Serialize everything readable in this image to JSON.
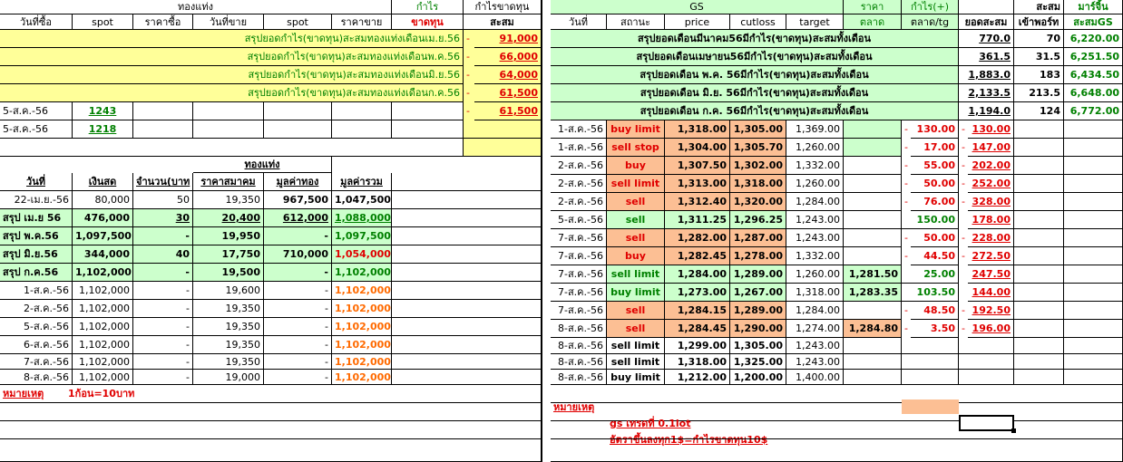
{
  "left": {
    "header1": {
      "gold": "ทองแท่ง",
      "profit": "กำไร",
      "profit_loss": "กำไรขาดทุน"
    },
    "header2": {
      "buy_date": "วันที่ซื้อ",
      "spot": "spot",
      "buy_price": "ราคาซื้อ",
      "sell_date": "วันที่ขาย",
      "spot2": "spot",
      "sell_price": "ราคาขาย",
      "loss": "ขาดทุน",
      "accum": "สะสม"
    },
    "summaries": [
      {
        "label": "สรุปยอดกำไร(ขาดทุน)สะสมทองแท่งเดือนเม.ย.56",
        "dash": "-",
        "value": "91,000"
      },
      {
        "label": "สรุปยอดกำไร(ขาดทุน)สะสมทองแท่งเดือนพ.ค.56",
        "dash": "-",
        "value": "66,000"
      },
      {
        "label": "สรุปยอดกำไร(ขาดทุน)สะสมทองแท่งเดือนมิ.ย.56",
        "dash": "-",
        "value": "64,000"
      },
      {
        "label": "สรุปยอดกำไร(ขาดทุน)สะสมทองแท่งเดือนก.ค.56",
        "dash": "-",
        "value": "61,500"
      }
    ],
    "open_rows": [
      {
        "date": "5-ส.ค.-56",
        "spot": "1243",
        "dash": "-",
        "value": "61,500"
      },
      {
        "date": "5-ส.ค.-56",
        "spot": "1218"
      }
    ],
    "gold_title": "ทองแท่ง",
    "table_headers": {
      "date": "วันที่",
      "cash": "เงินสด",
      "qty": "จำนวน(บาท",
      "price": "ราคาสมาคม",
      "gold_value": "มูลค่าทอง",
      "total": "มูลค่ารวม"
    },
    "rows": [
      {
        "date": "22-เม.ย.-56",
        "cash": "80,000",
        "qty": "50",
        "price": "19,350",
        "gold_value": "967,500",
        "total": "1,047,500"
      },
      {
        "date": "สรุป เม.ย 56",
        "cash": "476,000",
        "qty": "30",
        "price": "20,400",
        "gold_value": "612,000",
        "total": "1,088,000"
      },
      {
        "date": "สรุป พ.ค.56",
        "cash": "1,097,500",
        "qty": "-",
        "price": "19,950",
        "gold_value": "-",
        "total": "1,097,500"
      },
      {
        "date": "สรุป มิ.ย.56",
        "cash": "344,000",
        "qty": "40",
        "price": "17,750",
        "gold_value": "710,000",
        "total": "1,054,000"
      },
      {
        "date": "สรุป ก.ค.56",
        "cash": "1,102,000",
        "qty": "-",
        "price": "19,500",
        "gold_value": "-",
        "total": "1,102,000"
      },
      {
        "date": "1-ส.ค.-56",
        "cash": "1,102,000",
        "qty": "-",
        "price": "19,600",
        "gold_value": "-",
        "total": "1,102,000"
      },
      {
        "date": "2-ส.ค.-56",
        "cash": "1,102,000",
        "qty": "-",
        "price": "19,350",
        "gold_value": "-",
        "total": "1,102,000"
      },
      {
        "date": "5-ส.ค.-56",
        "cash": "1,102,000",
        "qty": "-",
        "price": "19,350",
        "gold_value": "-",
        "total": "1,102,000"
      },
      {
        "date": "6-ส.ค.-56",
        "cash": "1,102,000",
        "qty": "-",
        "price": "19,350",
        "gold_value": "-",
        "total": "1,102,000"
      },
      {
        "date": "7-ส.ค.-56",
        "cash": "1,102,000",
        "qty": "-",
        "price": "19,350",
        "gold_value": "-",
        "total": "1,102,000"
      },
      {
        "date": "8-ส.ค.-56",
        "cash": "1,102,000",
        "qty": "-",
        "price": "19,000",
        "gold_value": "-",
        "total": "1,102,000"
      }
    ],
    "note_label": "หมายเหตุ",
    "note_text": "1ก้อน=10บาท"
  },
  "right": {
    "header1": {
      "gs": "GS",
      "price": "ราคา",
      "profit": "กำไร(+)",
      "accum": "สะสม",
      "margin": "มาร์จิ้น"
    },
    "header2": {
      "date": "วันที่",
      "status": "สถานะ",
      "price": "price",
      "cutloss": "cutloss",
      "target": "target",
      "market": "ตลาด",
      "market_tg": "ตลาด/tg",
      "accum_total": "ยอดสะสม",
      "ports": "เข้าพอร์ท",
      "accum_gs": "สะสมGS"
    },
    "summaries": [
      {
        "label": "สรุปยอดเดือนมีนาคม56มีกำไร(ขาดทุน)สะสมทั้งเดือน",
        "total": "770.0",
        "ports": "70",
        "gs": "6,220.00"
      },
      {
        "label": "สรุปยอดเดือนเมษายน56มีกำไร(ขาดทุน)สะสมทั้งเดือน",
        "total": "361.5",
        "ports": "31.5",
        "gs": "6,251.50"
      },
      {
        "label": "สรุปยอดเดือน พ.ค. 56มีกำไร(ขาดทุน)สะสมทั้งเดือน",
        "total": "1,883.0",
        "ports": "183",
        "gs": "6,434.50"
      },
      {
        "label": "สรุปยอดเดือน มิ.ย. 56มีกำไร(ขาดทุน)สะสมทั้งเดือน",
        "total": "2,133.5",
        "ports": "213.5",
        "gs": "6,648.00"
      },
      {
        "label": "สรุปยอดเดือน ก.ค. 56มีกำไร(ขาดทุน)สะสมทั้งเดือน",
        "total": "1,194.0",
        "ports": "124",
        "gs": "6,772.00"
      }
    ],
    "trades": [
      {
        "date": "1-ส.ค.-56",
        "status": "buy limit",
        "price": "1,318.00",
        "cutloss": "1,305.00",
        "target": "1,369.00",
        "market": "",
        "dash": "-",
        "profit": "130.00",
        "accum": "130.00"
      },
      {
        "date": "1-ส.ค.-56",
        "status": "sell stop",
        "price": "1,304.00",
        "cutloss": "1,305.70",
        "target": "1,260.00",
        "market": "",
        "dash": "-",
        "profit": "17.00",
        "accum": "147.00"
      },
      {
        "date": "2-ส.ค.-56",
        "status": "buy",
        "price": "1,307.50",
        "cutloss": "1,302.00",
        "target": "1,332.00",
        "market": "",
        "dash": "-",
        "profit": "55.00",
        "accum": "202.00"
      },
      {
        "date": "2-ส.ค.-56",
        "status": "sell limit",
        "price": "1,313.00",
        "cutloss": "1,318.00",
        "target": "1,260.00",
        "market": "",
        "dash": "-",
        "profit": "50.00",
        "accum": "252.00"
      },
      {
        "date": "2-ส.ค.-56",
        "status": "sell",
        "price": "1,312.40",
        "cutloss": "1,320.00",
        "target": "1,284.00",
        "market": "",
        "dash": "-",
        "profit": "76.00",
        "accum": "328.00"
      },
      {
        "date": "5-ส.ค.-56",
        "status": "sell",
        "price": "1,311.25",
        "cutloss": "1,296.25",
        "target": "1,243.00",
        "market": "",
        "dash": "",
        "profit": "150.00",
        "accum": "178.00"
      },
      {
        "date": "7-ส.ค.-56",
        "status": "sell",
        "price": "1,282.00",
        "cutloss": "1,287.00",
        "target": "1,243.00",
        "market": "",
        "dash": "-",
        "profit": "50.00",
        "accum": "228.00"
      },
      {
        "date": "7-ส.ค.-56",
        "status": "buy",
        "price": "1,282.45",
        "cutloss": "1,278.00",
        "target": "1,332.00",
        "market": "",
        "dash": "-",
        "profit": "44.50",
        "accum": "272.50"
      },
      {
        "date": "7-ส.ค.-56",
        "status": "sell limit",
        "price": "1,284.00",
        "cutloss": "1,289.00",
        "target": "1,260.00",
        "market": "1,281.50",
        "dash": "",
        "profit": "25.00",
        "accum": "247.50"
      },
      {
        "date": "7-ส.ค.-56",
        "status": "buy limit",
        "price": "1,273.00",
        "cutloss": "1,267.00",
        "target": "1,318.00",
        "market": "1,283.35",
        "dash": "",
        "profit": "103.50",
        "accum": "144.00"
      },
      {
        "date": "7-ส.ค.-56",
        "status": "sell",
        "price": "1,284.15",
        "cutloss": "1,289.00",
        "target": "1,284.00",
        "market": "",
        "dash": "-",
        "profit": "48.50",
        "accum": "192.50"
      },
      {
        "date": "8-ส.ค.-56",
        "status": "sell",
        "price": "1,284.45",
        "cutloss": "1,290.00",
        "target": "1,274.00",
        "market": "1,284.80",
        "dash": "-",
        "profit": "3.50",
        "accum": "196.00"
      },
      {
        "date": "8-ส.ค.-56",
        "status": "sell limit",
        "price": "1,299.00",
        "cutloss": "1,305.00",
        "target": "1,243.00",
        "market": "",
        "dash": "",
        "profit": "",
        "accum": ""
      },
      {
        "date": "8-ส.ค.-56",
        "status": "sell limit",
        "price": "1,318.00",
        "cutloss": "1,325.00",
        "target": "1,243.00",
        "market": "",
        "dash": "",
        "profit": "",
        "accum": ""
      },
      {
        "date": "8-ส.ค.-56",
        "status": "buy limit",
        "price": "1,212.00",
        "cutloss": "1,200.00",
        "target": "1,400.00",
        "market": "",
        "dash": "",
        "profit": "",
        "accum": ""
      }
    ],
    "note_label": "หมายเหตุ",
    "note1": "gs เทรดที่ 0.1lot",
    "note2": "อัตราขึ้นลงทุก1$=กำไรขาดทุน10$"
  },
  "colors": {
    "yellow": "#ffff99",
    "green": "#ccffcc",
    "peach": "#fcbf94",
    "red": "#e00000",
    "dark_green": "#008000",
    "orange": "#ff6a00"
  }
}
